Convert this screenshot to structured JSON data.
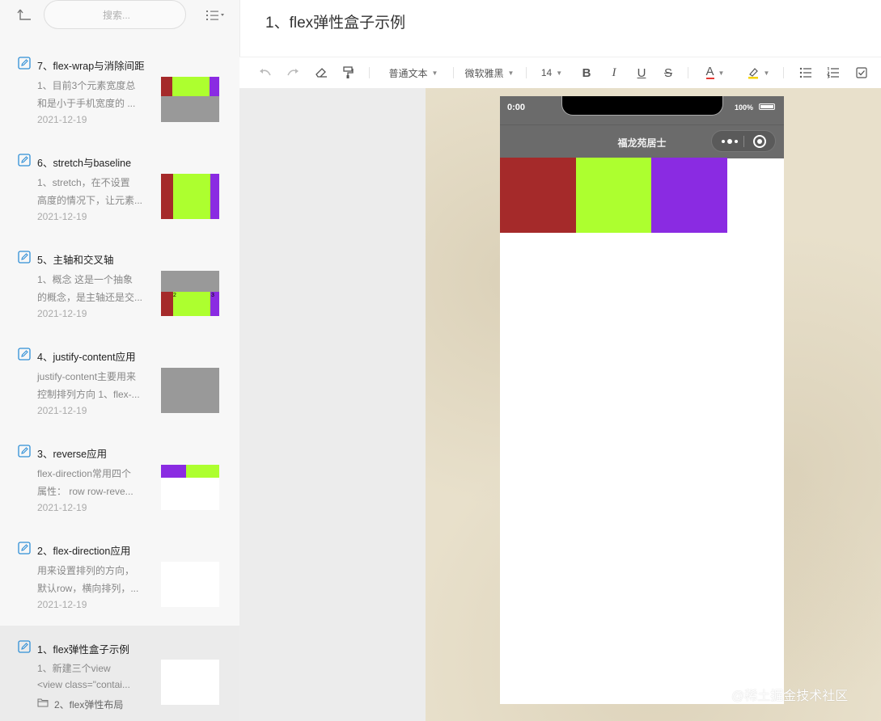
{
  "sidebar": {
    "search_placeholder": "搜索...",
    "notes": [
      {
        "title": "7、flex-wrap与消除间距",
        "line1": "1、目前3个元素宽度总",
        "line2": "和是小于手机宽度的 ...",
        "date": "2021-12-19"
      },
      {
        "title": "6、stretch与baseline",
        "line1": "1、stretch，在不设置",
        "line2": "高度的情况下，让元素...",
        "date": "2021-12-19"
      },
      {
        "title": "5、主轴和交叉轴",
        "line1": "1、概念 这是一个抽象",
        "line2": "的概念，是主轴还是交...",
        "date": "2021-12-19",
        "thumb_labels": [
          "2",
          "3"
        ]
      },
      {
        "title": "4、justify-content应用",
        "line1": "justify-content主要用来",
        "line2": "控制排列方向 1、flex-...",
        "date": "2021-12-19"
      },
      {
        "title": "3、reverse应用",
        "line1": "flex-direction常用四个",
        "line2": "属性： row row-reve...",
        "date": "2021-12-19"
      },
      {
        "title": "2、flex-direction应用",
        "line1": "用来设置排列的方向，",
        "line2": "默认row，横向排列，...",
        "date": "2021-12-19"
      },
      {
        "title": "1、flex弹性盒子示例",
        "line1": "1、新建三个view",
        "line2": "<view class=\"contai...",
        "folder": "2、flex弹性布局",
        "active": true
      }
    ]
  },
  "document": {
    "title": "1、flex弹性盒子示例"
  },
  "toolbar": {
    "paragraph_style": "普通文本",
    "font_family": "微软雅黑",
    "font_size": "14",
    "bold": "B",
    "italic": "I",
    "underline": "U",
    "strike": "S",
    "font_color": "A"
  },
  "phone": {
    "time": "0:00",
    "battery": "100%",
    "nav_title": "福龙苑居士"
  },
  "colors": {
    "box_red": "#a52a2a",
    "box_green": "#adff2f",
    "box_purple": "#8a2be2",
    "thumb_gray": "#999999",
    "accent_blue": "#2f8fd6"
  },
  "watermark": "@稀土掘金技术社区"
}
